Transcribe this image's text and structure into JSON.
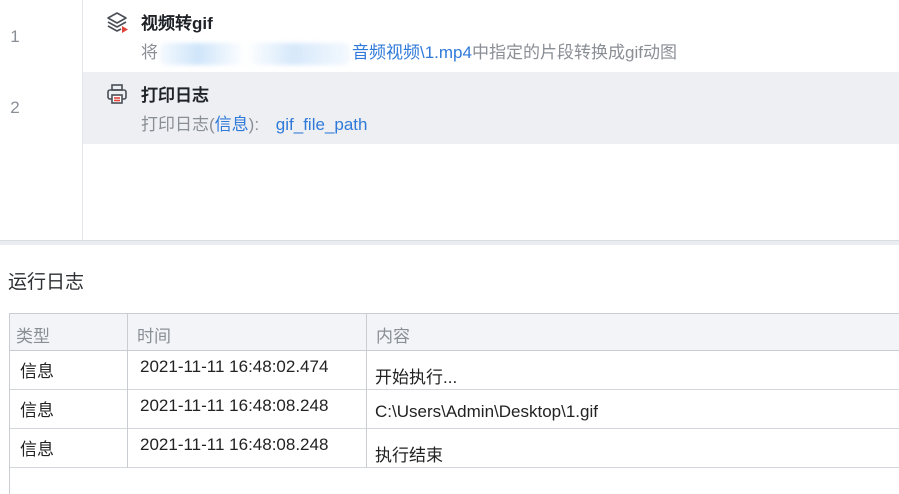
{
  "steps": [
    {
      "line": "1",
      "title": "视频转gif",
      "icon": "layers-icon",
      "desc_prefix": "将",
      "desc_link": "视频\\1.mp4",
      "desc_link_prefix": "音频",
      "desc_suffix": "中指定的片段转换成gif动图"
    },
    {
      "line": "2",
      "title": "打印日志",
      "icon": "printer-icon",
      "desc_prefix": "打印日志(",
      "desc_level": "信息",
      "desc_colon": "):",
      "desc_var": "gif_file_path"
    }
  ],
  "log": {
    "title": "运行日志",
    "columns": [
      "类型",
      "时间",
      "内容"
    ],
    "rows": [
      {
        "type": "信息",
        "time": "2021-11-11 16:48:02.474",
        "content": "开始执行..."
      },
      {
        "type": "信息",
        "time": "2021-11-11 16:48:08.248",
        "content": "C:\\Users\\Admin\\Desktop\\1.gif"
      },
      {
        "type": "信息",
        "time": "2021-11-11 16:48:08.248",
        "content": "执行结束"
      }
    ]
  },
  "colors": {
    "link": "#2f7ad9",
    "selected_bg": "#edeff3",
    "icon_accent": "#e0443a"
  }
}
